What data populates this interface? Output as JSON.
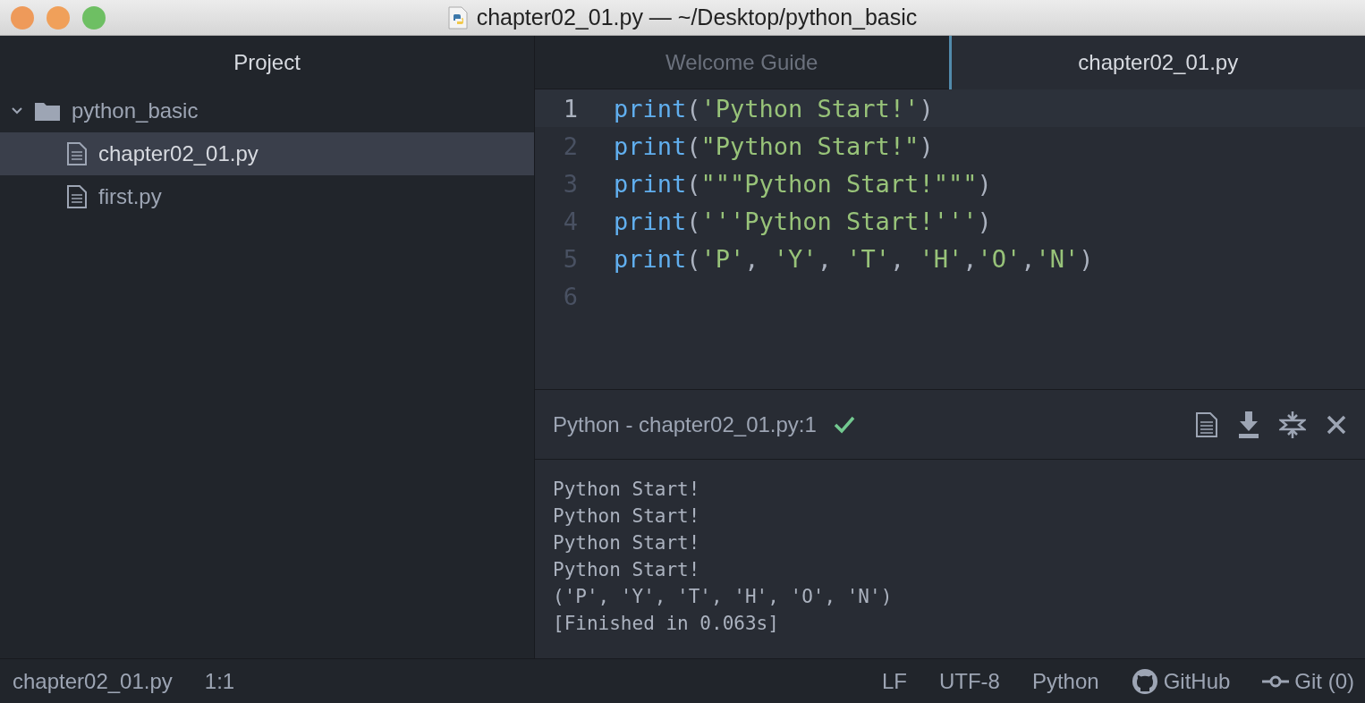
{
  "window": {
    "title": "chapter02_01.py — ~/Desktop/python_basic"
  },
  "sidebar": {
    "title": "Project",
    "tree": [
      {
        "label": "python_basic",
        "kind": "folder",
        "expanded": true,
        "children": [
          {
            "label": "chapter02_01.py",
            "kind": "file",
            "selected": true
          },
          {
            "label": "first.py",
            "kind": "file",
            "selected": false
          }
        ]
      }
    ]
  },
  "tabs": [
    {
      "label": "Welcome Guide",
      "selected": false
    },
    {
      "label": "chapter02_01.py",
      "selected": true
    }
  ],
  "editor": {
    "lines": [
      {
        "number": "1",
        "selected": true,
        "tokens": [
          {
            "kind": "func",
            "text": "print"
          },
          {
            "kind": "punct",
            "text": "("
          },
          {
            "kind": "string",
            "text": "'Python Start!'"
          },
          {
            "kind": "punct",
            "text": ")"
          }
        ]
      },
      {
        "number": "2",
        "selected": false,
        "tokens": [
          {
            "kind": "func",
            "text": "print"
          },
          {
            "kind": "punct",
            "text": "("
          },
          {
            "kind": "string",
            "text": "\"Python Start!\""
          },
          {
            "kind": "punct",
            "text": ")"
          }
        ]
      },
      {
        "number": "3",
        "selected": false,
        "tokens": [
          {
            "kind": "func",
            "text": "print"
          },
          {
            "kind": "punct",
            "text": "("
          },
          {
            "kind": "string",
            "text": "\"\"\"Python Start!\"\"\""
          },
          {
            "kind": "punct",
            "text": ")"
          }
        ]
      },
      {
        "number": "4",
        "selected": false,
        "tokens": [
          {
            "kind": "func",
            "text": "print"
          },
          {
            "kind": "punct",
            "text": "("
          },
          {
            "kind": "string",
            "text": "'''Python Start!'''"
          },
          {
            "kind": "punct",
            "text": ")"
          }
        ]
      },
      {
        "number": "5",
        "selected": false,
        "tokens": [
          {
            "kind": "func",
            "text": "print"
          },
          {
            "kind": "punct",
            "text": "("
          },
          {
            "kind": "string",
            "text": "'P'"
          },
          {
            "kind": "punct",
            "text": ", "
          },
          {
            "kind": "string",
            "text": "'Y'"
          },
          {
            "kind": "punct",
            "text": ", "
          },
          {
            "kind": "string",
            "text": "'T'"
          },
          {
            "kind": "punct",
            "text": ", "
          },
          {
            "kind": "string",
            "text": "'H'"
          },
          {
            "kind": "punct",
            "text": ","
          },
          {
            "kind": "string",
            "text": "'O'"
          },
          {
            "kind": "punct",
            "text": ","
          },
          {
            "kind": "string",
            "text": "'N'"
          },
          {
            "kind": "punct",
            "text": ")"
          }
        ]
      },
      {
        "number": "6",
        "selected": false
      }
    ]
  },
  "output": {
    "title": "Python - chapter02_01.py:1",
    "success": true,
    "lines": [
      "Python Start!",
      "Python Start!",
      "Python Start!",
      "Python Start!",
      "('P', 'Y', 'T', 'H', 'O', 'N')",
      "[Finished in 0.063s]"
    ]
  },
  "status_bar": {
    "file": "chapter02_01.py",
    "cursor": "1:1",
    "line_ending": "LF",
    "encoding": "UTF-8",
    "grammar": "Python",
    "github": "GitHub",
    "git": "Git (0)"
  }
}
